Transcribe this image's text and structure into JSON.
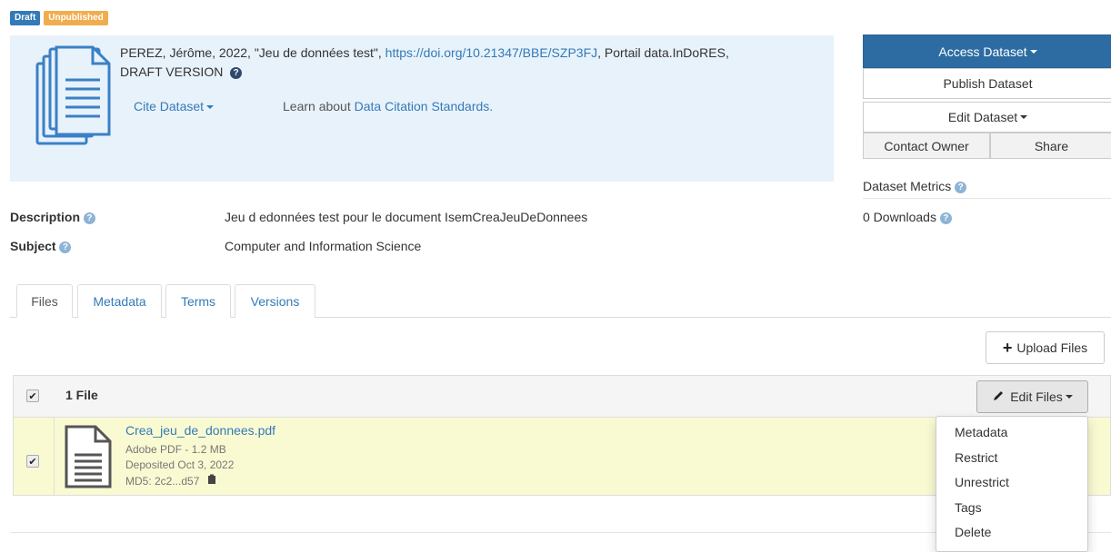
{
  "badges": {
    "draft": "Draft",
    "unpublished": "Unpublished"
  },
  "citation": {
    "text": "PEREZ, Jérôme, 2022, \"Jeu de données test\", ",
    "doi": "https://doi.org/10.21347/BBE/SZP3FJ",
    "text_after": ", Portail data.InDoRES,",
    "version": "DRAFT VERSION",
    "help_glyph": "?",
    "cite_label": "Cite Dataset",
    "learn_text": "Learn about ",
    "learn_link": "Data Citation Standards."
  },
  "actions": {
    "access": "Access Dataset",
    "publish": "Publish Dataset",
    "edit": "Edit Dataset",
    "contact": "Contact Owner",
    "share": "Share"
  },
  "metrics": {
    "title": "Dataset Metrics",
    "downloads": "0 Downloads"
  },
  "metadata": {
    "description_label": "Description",
    "description_value": "Jeu d edonnées test pour le document IsemCreaJeuDeDonnees",
    "subject_label": "Subject",
    "subject_value": "Computer and Information Science"
  },
  "tabs": [
    {
      "label": "Files"
    },
    {
      "label": "Metadata"
    },
    {
      "label": "Terms"
    },
    {
      "label": "Versions"
    }
  ],
  "files": {
    "upload_label": "Upload Files",
    "count_label": "1 File",
    "edit_files_label": "Edit Files",
    "item": {
      "name": "Crea_jeu_de_donnees.pdf",
      "type_size": "Adobe PDF - 1.2 MB",
      "deposited": "Deposited Oct 3, 2022",
      "md5": "MD5: 2c2...d57"
    },
    "menu": [
      "Metadata",
      "Restrict",
      "Unrestrict",
      "Tags",
      "Delete"
    ]
  },
  "colors": {
    "primary": "#2d6ca2",
    "link": "#337ab7",
    "citation_bg": "#e8f2fb",
    "file_row_bg": "#fafad2",
    "draft": "#337ab7",
    "unpublished": "#f0ad4e"
  },
  "icons": [
    "document-stack-icon",
    "file-pdf-icon",
    "question-icon",
    "plus-icon",
    "pencil-icon",
    "clipboard-icon",
    "check-icon"
  ]
}
